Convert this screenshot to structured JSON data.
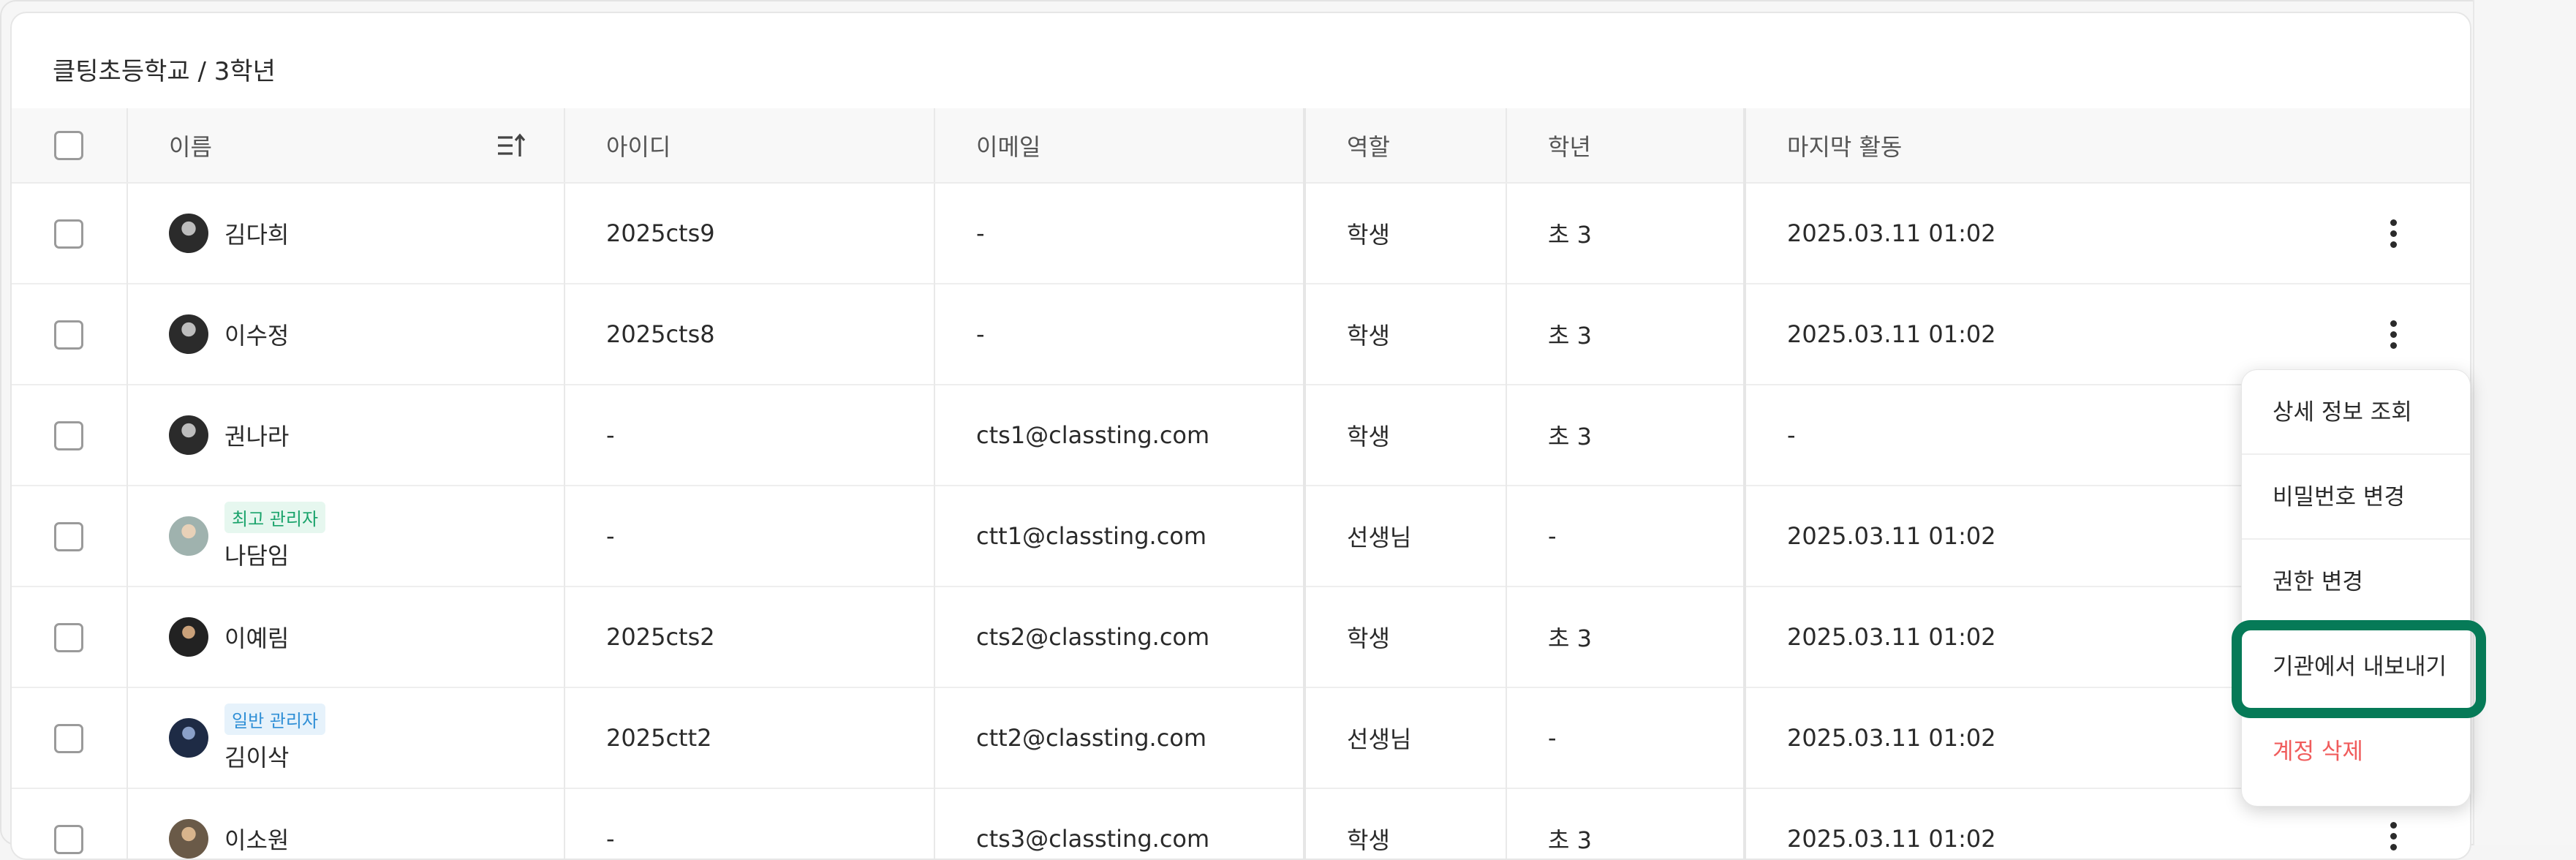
{
  "breadcrumb": "클팅초등학교 / 3학년",
  "columns": {
    "name": "이름",
    "id": "아이디",
    "email": "이메일",
    "role": "역할",
    "grade": "학년",
    "last_active": "마지막 활동"
  },
  "rows": [
    {
      "name": "김다희",
      "badge": "",
      "id": "2025cts9",
      "email": "-",
      "role": "학생",
      "grade": "초 3",
      "last_active": "2025.03.11 01:02"
    },
    {
      "name": "이수정",
      "badge": "",
      "id": "2025cts8",
      "email": "-",
      "role": "학생",
      "grade": "초 3",
      "last_active": "2025.03.11 01:02"
    },
    {
      "name": "권나라",
      "badge": "",
      "id": "-",
      "email": "cts1@classting.com",
      "role": "학생",
      "grade": "초 3",
      "last_active": "-"
    },
    {
      "name": "나담임",
      "badge": "최고 관리자",
      "id": "-",
      "email": "ctt1@classting.com",
      "role": "선생님",
      "grade": "-",
      "last_active": "2025.03.11 01:02"
    },
    {
      "name": "이예림",
      "badge": "",
      "id": "2025cts2",
      "email": "cts2@classting.com",
      "role": "학생",
      "grade": "초 3",
      "last_active": "2025.03.11 01:02"
    },
    {
      "name": "김이삭",
      "badge": "일반 관리자",
      "id": "2025ctt2",
      "email": "ctt2@classting.com",
      "role": "선생님",
      "grade": "-",
      "last_active": "2025.03.11 01:02"
    },
    {
      "name": "이소원",
      "badge": "",
      "id": "-",
      "email": "cts3@classting.com",
      "role": "학생",
      "grade": "초 3",
      "last_active": "2025.03.11 01:02"
    }
  ],
  "menu": {
    "view_details": "상세 정보 조회",
    "change_password": "비밀번호 변경",
    "change_permission": "권한 변경",
    "export_from_org": "기관에서 내보내기",
    "delete_account": "계정 삭제"
  },
  "colors": {
    "highlight": "#067a57",
    "danger": "#f05c5c",
    "badge_green": "#1aa36b",
    "badge_blue": "#2f8fd6"
  }
}
